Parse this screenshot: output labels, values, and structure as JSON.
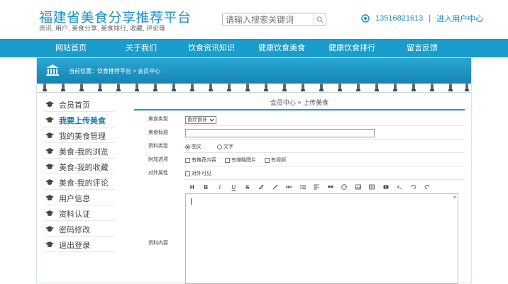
{
  "header": {
    "title": "福建省美食分享推荐平台",
    "subtitle": "资讯, 用户, 美食分享, 美食排行, 收藏, 评论等",
    "search_placeholder": "请输入搜索关键词",
    "phone": "13516821613",
    "separator": "|",
    "user_center_link": "进入用户中心"
  },
  "nav": {
    "items": [
      "网站首页",
      "关于我们",
      "饮食资讯知识",
      "健康饮食美食",
      "健康饮食排行",
      "留言反馈"
    ]
  },
  "breadcrumb": "当前位置：饮食推荐平台 > 会员中心",
  "sidebar": {
    "items": [
      "会员首页",
      "我要上传美食",
      "我的美食管理",
      "美食-我的浏览",
      "美食-我的收藏",
      "美食-我的评论",
      "用户信息",
      "资料认证",
      "密码修改",
      "退出登录"
    ],
    "active_index": 1
  },
  "content": {
    "heading": "会员中心 > 上传美食",
    "fields": {
      "food_type_label": "美食类型",
      "food_type_value": "食疗食补",
      "food_title_label": "美食标题",
      "material_type_label": "资料类型",
      "material_opt1": "图文",
      "material_opt2": "文字",
      "extra_label": "附加选项",
      "extra_opt1": "有推荐内容",
      "extra_opt2": "有缩略图片",
      "extra_opt3": "有视频",
      "visibility_label": "对外属性",
      "visibility_opt": "对外可见",
      "content_label": "资料内容"
    },
    "toolbar": [
      "H",
      "B",
      "I",
      "U",
      "S"
    ]
  },
  "colors": {
    "brand": "#1a8fc0",
    "nav_bg": "#1a9ccc"
  }
}
